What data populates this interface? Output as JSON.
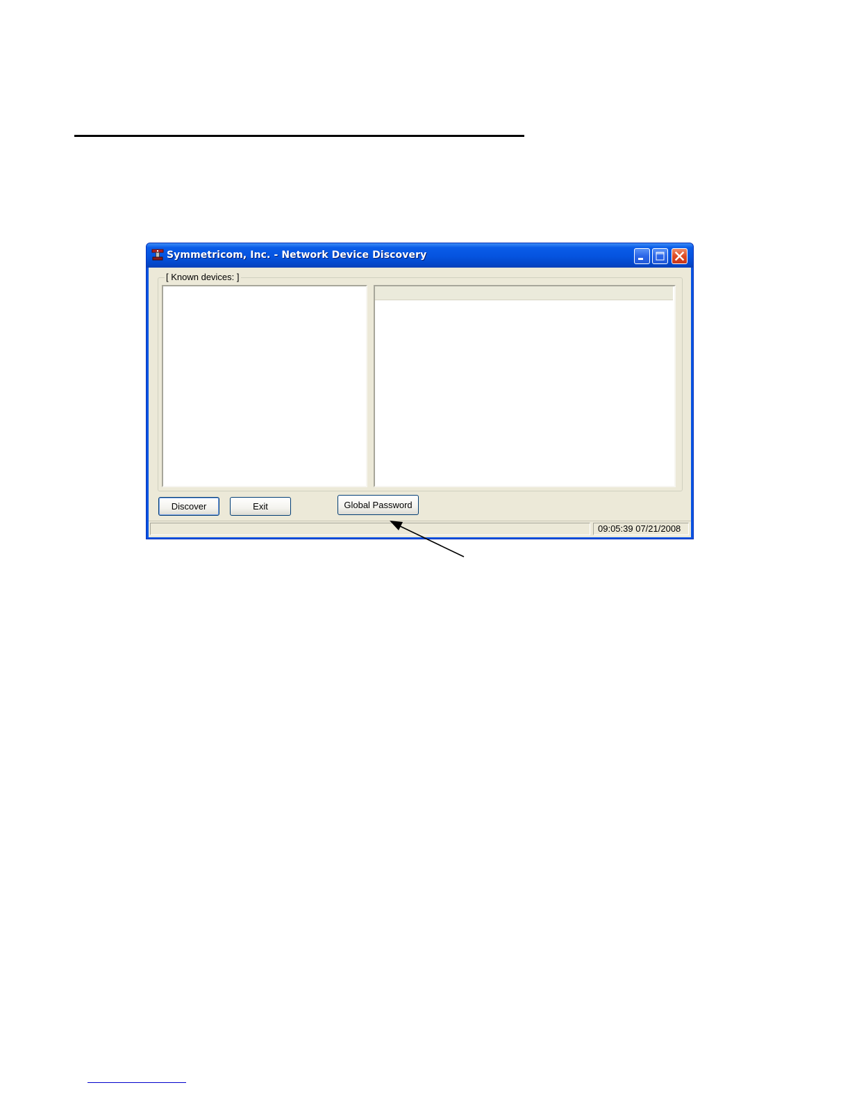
{
  "window": {
    "title": "Symmetricom, Inc. - Network Device Discovery",
    "icon": "app-icon",
    "controls": [
      "minimize-icon",
      "maximize-icon",
      "close-icon"
    ]
  },
  "main": {
    "group_label": "[ Known devices: ]",
    "device_list_items": [],
    "details_columns": []
  },
  "buttons": {
    "discover_label": "Discover",
    "exit_label": "Exit",
    "global_password_label": "Global Password"
  },
  "status_bar": {
    "message": "",
    "datetime": "09:05:39 07/21/2008"
  },
  "colors": {
    "titlebar": "#0553df",
    "client_background": "#ece9d8",
    "close_button": "#de4b24",
    "callout_arrow": "#000000"
  }
}
